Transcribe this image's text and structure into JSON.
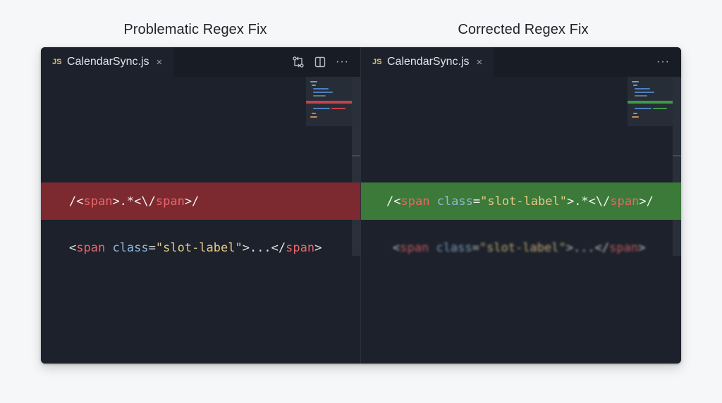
{
  "headings": {
    "left": "Problematic Regex Fix",
    "right": "Corrected Regex Fix"
  },
  "left_pane": {
    "tab": {
      "badge": "JS",
      "filename": "CalendarSync.js",
      "close": "×"
    },
    "actions": [
      "compare-changes-icon",
      "split-editor-icon",
      "more-icon"
    ],
    "more_label": "···",
    "highlight": "#7c2a30",
    "regex_line": {
      "p1": "/<",
      "tag1": "span",
      "p2": ">.*<\\/",
      "tag2": "span",
      "p3": ">/"
    },
    "html_line": {
      "p1": "<",
      "tag1": "span",
      "attr": "class",
      "eq": "=",
      "str": "\"slot-label\"",
      "p2": ">...</",
      "tag2": "span",
      "p3": ">"
    }
  },
  "right_pane": {
    "tab": {
      "badge": "JS",
      "filename": "CalendarSync.js",
      "close": "×"
    },
    "actions": [
      "more-icon"
    ],
    "more_label": "···",
    "highlight": "#3c7a3a",
    "regex_line": {
      "p1": "/<",
      "tag1": "span",
      "sp": " ",
      "attr": "class",
      "eq": "=",
      "str": "\"slot-label\"",
      "p2": ">.*<\\/",
      "tag2": "span",
      "p3": ">/"
    },
    "html_line": {
      "p1": "<",
      "tag1": "span",
      "attr": "class",
      "eq": "=",
      "str": "\"slot-label\"",
      "p2": ">...</",
      "tag2": "span",
      "p3": ">"
    }
  },
  "colors": {
    "editor_bg": "#1c212b",
    "tag": "#e8676c",
    "attr": "#8fb8d8",
    "string": "#e6c987",
    "error_highlight": "#7c2a30",
    "success_highlight": "#3c7a3a"
  }
}
